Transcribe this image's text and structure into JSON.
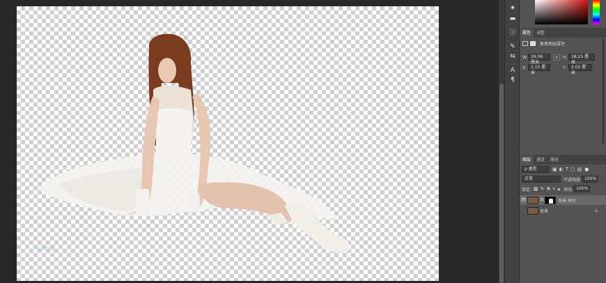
{
  "properties_panel": {
    "tabs": [
      "属性",
      "调整"
    ],
    "active_tab": "属性",
    "layer_type_label": "像素图层属性",
    "width_label": "W:",
    "width_value": "26.06 厘米",
    "height_label": "H:",
    "height_value": "18.25 厘米",
    "link_icon": "link-icon",
    "x_label": "X:",
    "x_value": "1.15 厘米",
    "y_label": "Y:",
    "y_value": "2.02 厘米"
  },
  "layers_panel": {
    "tabs": [
      "图层",
      "通道",
      "路径"
    ],
    "active_tab": "图层",
    "filter_kind": "ρ 类型",
    "blend_mode": "正常",
    "opacity_label": "不透明度:",
    "opacity_value": "100%",
    "lock_label": "锁定:",
    "fill_label": "填充:",
    "fill_value": "100%",
    "layers": [
      {
        "name": "背景 拷贝",
        "visible": true,
        "selected": true,
        "has_mask": true
      },
      {
        "name": "背景",
        "visible": false,
        "selected": false,
        "locked": true
      }
    ]
  },
  "colors": {
    "accent_selected_layer": "#686868",
    "panel_bg": "#535353",
    "canvas_checker": "#cfcfcf"
  }
}
